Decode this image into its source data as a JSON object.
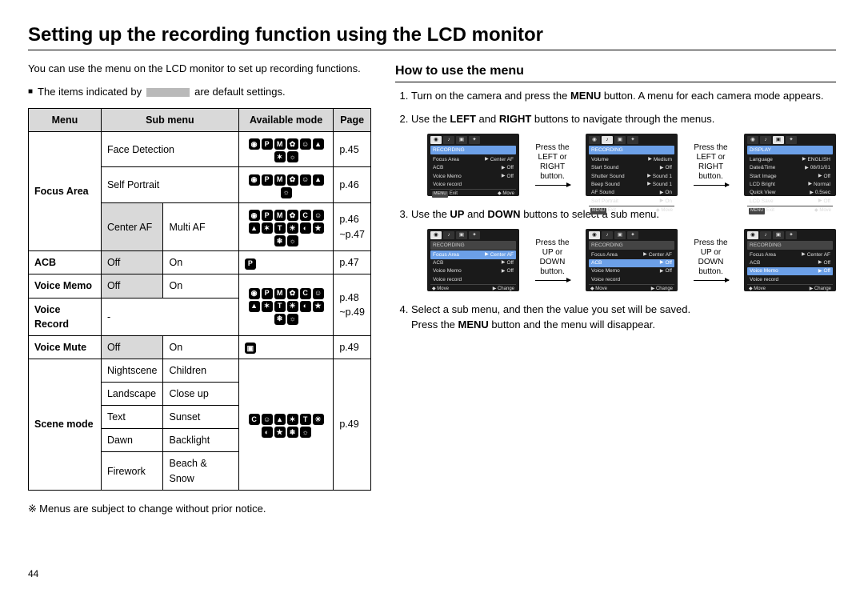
{
  "title": "Setting up the recording function using the LCD monitor",
  "intro": "You can use the menu on the LCD monitor to set up recording functions.",
  "default_note": {
    "prefix": "The items indicated by",
    "suffix": "are default settings."
  },
  "table": {
    "headers": {
      "menu": "Menu",
      "sub": "Sub menu",
      "mode": "Available mode",
      "page": "Page"
    },
    "rows": {
      "focus_area": "Focus Area",
      "face_detection": "Face Detection",
      "self_portrait": "Self Portrait",
      "center_af": "Center AF",
      "multi_af": "Multi AF",
      "acb": "ACB",
      "voice_memo": "Voice Memo",
      "voice_record": "Voice Record",
      "voice_mute": "Voice Mute",
      "scene_mode": "Scene mode",
      "off": "Off",
      "on": "On",
      "dash": "-",
      "nightscene": "Nightscene",
      "children": "Children",
      "landscape": "Landscape",
      "closeup": "Close up",
      "text": "Text",
      "sunset": "Sunset",
      "dawn": "Dawn",
      "backlight": "Backlight",
      "firework": "Firework",
      "beach_snow": "Beach & Snow"
    },
    "pages": {
      "p45": "p.45",
      "p46": "p.46",
      "p46_47": "p.46\n~p.47",
      "p47": "p.47",
      "p48_49": "p.48\n~p.49",
      "p49": "p.49"
    }
  },
  "footnote": "Menus are subject to change without prior notice.",
  "pagenum": "44",
  "right": {
    "subhead": "How to use the menu",
    "step1a": "Turn on the camera and press the ",
    "step1b": " button. A menu for each camera mode appears.",
    "step2a": "Use the ",
    "step2b": " and ",
    "step2c": " buttons to navigate through the menus.",
    "step3a": "Use the ",
    "step3b": " and ",
    "step3c": " buttons to select a sub menu.",
    "step4a": "Select a sub menu, and then the value you set will be saved.",
    "step4b": "Press the ",
    "step4c": " button and the menu will disappear.",
    "bold": {
      "menu": "MENU",
      "left": "LEFT",
      "right": "RIGHT",
      "up": "UP",
      "down": "DOWN"
    },
    "captions": {
      "lr": "Press the LEFT or RIGHT button.",
      "ud": "Press the UP or DOWN button."
    }
  },
  "screens": {
    "rec_header": "RECORDING",
    "disp_header": "DISPLAY",
    "footer_exit": "Exit",
    "footer_move": "Move",
    "footer_change": "Change",
    "menu_btn": "MENU",
    "rec1": [
      {
        "l": "Focus Area",
        "r": "Center AF"
      },
      {
        "l": "ACB",
        "r": "Off"
      },
      {
        "l": "Voice Memo",
        "r": "Off"
      },
      {
        "l": "Voice record",
        "r": ""
      }
    ],
    "rec2": [
      {
        "l": "Volume",
        "r": "Medium"
      },
      {
        "l": "Start Sound",
        "r": "Off"
      },
      {
        "l": "Shutter Sound",
        "r": "Sound 1"
      },
      {
        "l": "Beep Sound",
        "r": "Sound 1"
      },
      {
        "l": "AF Sound",
        "r": "On"
      },
      {
        "l": "Self Portrait",
        "r": "On"
      }
    ],
    "disp": [
      {
        "l": "Language",
        "r": "ENGLISH"
      },
      {
        "l": "Date&Time",
        "r": "08/01/01"
      },
      {
        "l": "Start Image",
        "r": "Off"
      },
      {
        "l": "LCD Bright",
        "r": "Normal"
      },
      {
        "l": "Quick View",
        "r": "0.5sec"
      },
      {
        "l": "LCD Save",
        "r": "Off"
      }
    ]
  }
}
